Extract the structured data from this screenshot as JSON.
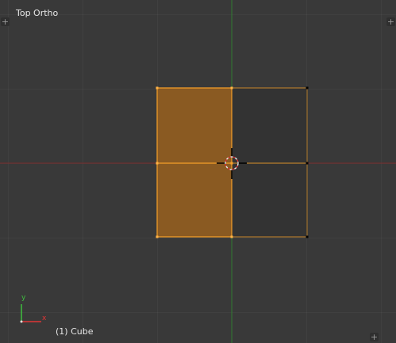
{
  "viewport": {
    "view_title": "Top Ortho",
    "object_label": "(1) Cube",
    "corner_glyph": "+"
  },
  "axes_gizmo": {
    "y_label": "y",
    "x_label": "x",
    "y_color": "#3fbf3f",
    "x_color": "#e03535"
  },
  "colors": {
    "background": "#393939",
    "selected_face": "#8a5a22",
    "unselected_face": "#333333",
    "selected_edge": "#f59f2a",
    "unselected_edge": "#111111",
    "x_axis_line": "#7a2a2a",
    "y_axis_line": "#2e7a2e",
    "cursor_ring": "#e9e9e9",
    "cursor_ring_alt": "#d03030"
  }
}
